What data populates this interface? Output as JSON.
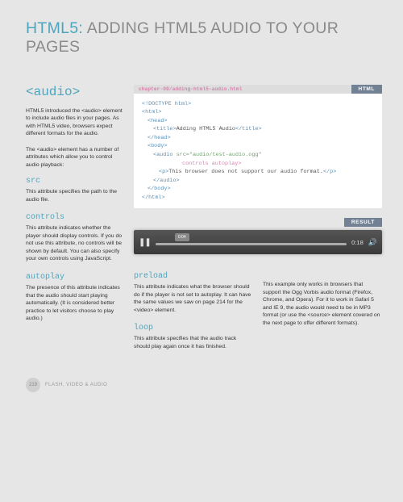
{
  "title": {
    "accent": "HTML5:",
    "rest": " ADDING HTML5 AUDIO TO YOUR PAGES"
  },
  "left": {
    "tag_heading": "<audio>",
    "intro1": "HTML5 introduced the <audio> element to include audio files in your pages. As with HTML5 video, browsers expect different formats for the audio.",
    "intro2": "The <audio> element has a number of attributes which allow you to control audio playback:",
    "src": {
      "name": "src",
      "desc": "This attribute specifies the path to the audio file."
    },
    "controls": {
      "name": "controls",
      "desc": "This attribute indicates whether the player should display controls. If you do not use this attribute, no controls will be shown by default. You can also specify your own controls using JavaScript."
    },
    "autoplay": {
      "name": "autoplay",
      "desc": "The presence of this attribute indicates that the audio should start playing automatically. (It is considered better practice to let visitors choose to play audio.)"
    }
  },
  "code": {
    "path": "chapter-09/adding-html5-audio.html",
    "badge": "HTML",
    "l1": "<!DOCTYPE html>",
    "l2": "<html>",
    "l3": "<head>",
    "l4a": "<title>",
    "l4b": "Adding HTML5 Audio",
    "l4c": "</title>",
    "l5": "</head>",
    "l6": "<body>",
    "l7a": "<audio ",
    "l7b": "src=\"audio/test-audio.ogg\"",
    "l8": "controls autoplay>",
    "l9a": "<p>",
    "l9b": "This browser does not support our audio format.",
    "l9c": "</p>",
    "l10": "</audio>",
    "l11": "</body>",
    "l12": "</html>"
  },
  "result": {
    "badge": "RESULT",
    "elapsed": "0:04",
    "duration": "0:18"
  },
  "lower": {
    "preload": {
      "name": "preload",
      "desc": "This attribute indicates what the browser should do if the player is not set to autoplay. It can have the same values we saw on page 214 for the <video> element."
    },
    "loop": {
      "name": "loop",
      "desc": "This attribute specifies that the audio track should play again once it has finished."
    },
    "note": "This example only works in browsers that support the Ogg Vorbis audio format (Firefox, Chrome, and Opera). For it to work in Safari 5 and IE 9, the audio would need to be in MP3 format (or use the <source> element covered on the next page to offer different formats)."
  },
  "footer": {
    "page": "219",
    "text": "FLASH, VIDEO & AUDIO"
  }
}
